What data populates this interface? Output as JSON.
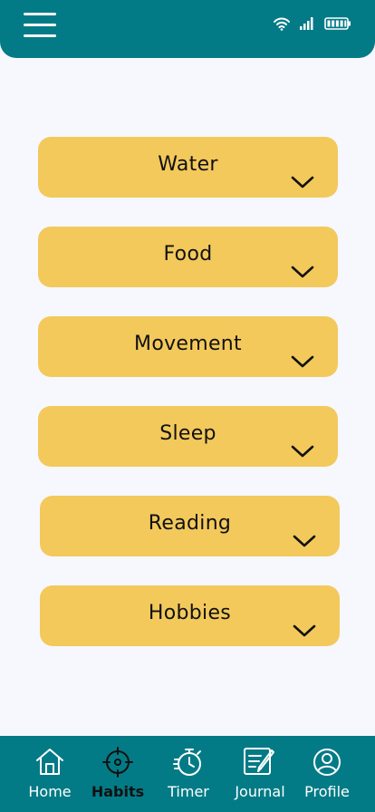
{
  "header": {
    "menu_icon": "hamburger-menu-icon",
    "status_icons": [
      "wifi-icon",
      "cellular-signal-icon",
      "battery-icon"
    ]
  },
  "habits": [
    {
      "label": "Water",
      "icon": "chevron-down-icon"
    },
    {
      "label": "Food",
      "icon": "chevron-down-icon"
    },
    {
      "label": "Movement",
      "icon": "chevron-down-icon"
    },
    {
      "label": "Sleep",
      "icon": "chevron-down-icon"
    },
    {
      "label": "Reading",
      "icon": "chevron-down-icon"
    },
    {
      "label": "Hobbies",
      "icon": "chevron-down-icon"
    }
  ],
  "nav": {
    "active": "Habits",
    "items": [
      {
        "label": "Home",
        "icon": "home-icon"
      },
      {
        "label": "Habits",
        "icon": "target-icon"
      },
      {
        "label": "Timer",
        "icon": "stopwatch-icon"
      },
      {
        "label": "Journal",
        "icon": "journal-icon"
      },
      {
        "label": "Profile",
        "icon": "profile-icon"
      }
    ]
  },
  "colors": {
    "header_bg": "#037b86",
    "page_bg": "#f6f8fd",
    "card_bg": "#f3c95c",
    "text_dark": "#111111",
    "text_light": "#ffffff"
  }
}
